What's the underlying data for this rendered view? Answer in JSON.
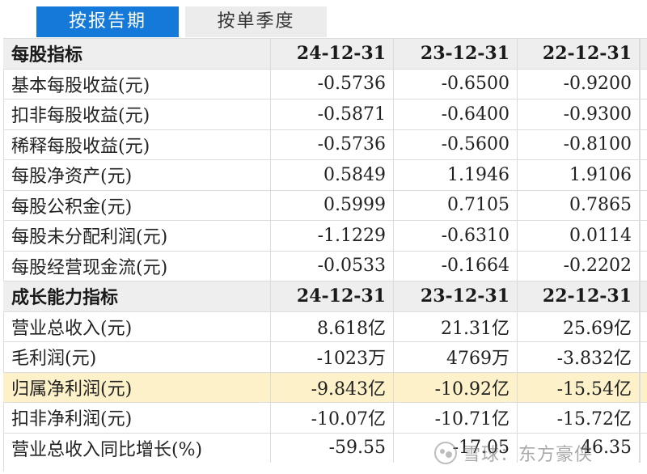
{
  "tabs": {
    "by_report_period": "按报告期",
    "by_single_quarter": "按单季度"
  },
  "colors": {
    "tab_active_bg": "#1479d9",
    "tab_inactive_bg": "#ececec",
    "header_bg": "#eeeeee",
    "highlight_row_bg": "#fcf1c9"
  },
  "per_share": {
    "section_title": "每股指标",
    "periods": [
      "24-12-31",
      "23-12-31",
      "22-12-31"
    ],
    "rows": [
      {
        "label": "基本每股收益(元)",
        "values": [
          "-0.5736",
          "-0.6500",
          "-0.9200"
        ]
      },
      {
        "label": "扣非每股收益(元)",
        "values": [
          "-0.5871",
          "-0.6400",
          "-0.9300"
        ]
      },
      {
        "label": "稀释每股收益(元)",
        "values": [
          "-0.5736",
          "-0.5600",
          "-0.8100"
        ]
      },
      {
        "label": "每股净资产(元)",
        "values": [
          "0.5849",
          "1.1946",
          "1.9106"
        ]
      },
      {
        "label": "每股公积金(元)",
        "values": [
          "0.5999",
          "0.7105",
          "0.7865"
        ]
      },
      {
        "label": "每股未分配利润(元)",
        "values": [
          "-1.1229",
          "-0.6310",
          "0.0114"
        ]
      },
      {
        "label": "每股经营现金流(元)",
        "values": [
          "-0.0533",
          "-0.1664",
          "-0.2202"
        ]
      }
    ]
  },
  "growth": {
    "section_title": "成长能力指标",
    "periods": [
      "24-12-31",
      "23-12-31",
      "22-12-31"
    ],
    "rows": [
      {
        "label": "营业总收入(元)",
        "values": [
          "8.618亿",
          "21.31亿",
          "25.69亿"
        ]
      },
      {
        "label": "毛利润(元)",
        "values": [
          "-1023万",
          "4769万",
          "-3.832亿"
        ]
      },
      {
        "label": "归属净利润(元)",
        "values": [
          "-9.843亿",
          "-10.92亿",
          "-15.54亿"
        ]
      },
      {
        "label": "扣非净利润(元)",
        "values": [
          "-10.07亿",
          "-10.71亿",
          "-15.72亿"
        ]
      },
      {
        "label": "营业总收入同比增长(%)",
        "values": [
          "-59.55",
          "-17.05",
          "46.35"
        ]
      }
    ]
  },
  "watermark": {
    "text": "雪球：东方豪侠"
  }
}
